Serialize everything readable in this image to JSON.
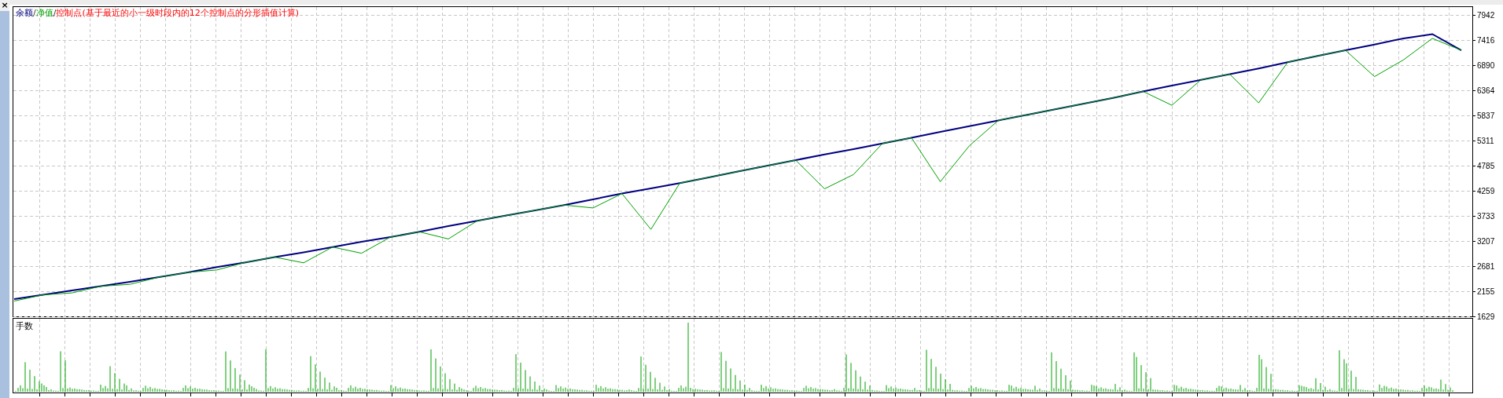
{
  "close_button": {
    "label": "×"
  },
  "legend": {
    "separator": "/",
    "label": "控制点(基于最近的小一级时段内的12个控制点的分形插值计算)"
  },
  "chart_data": {
    "type": "line",
    "grid": true,
    "series": [
      {
        "name": "余额",
        "color": "#000080",
        "values": [
          1990,
          2080,
          2170,
          2260,
          2350,
          2450,
          2550,
          2660,
          2760,
          2870,
          2970,
          3080,
          3190,
          3290,
          3400,
          3520,
          3630,
          3740,
          3850,
          3960,
          4080,
          4200,
          4310,
          4420,
          4540,
          4660,
          4780,
          4900,
          5020,
          5130,
          5250,
          5370,
          5490,
          5610,
          5730,
          5850,
          5970,
          6090,
          6210,
          6340,
          6460,
          6580,
          6700,
          6820,
          6950,
          7080,
          7200,
          7320,
          7450,
          7540,
          7200
        ]
      },
      {
        "name": "净值",
        "color": "#00a000",
        "values": [
          1950,
          2080,
          2120,
          2260,
          2300,
          2450,
          2550,
          2600,
          2760,
          2870,
          2750,
          3080,
          2950,
          3290,
          3400,
          3250,
          3630,
          3740,
          3850,
          3960,
          3900,
          4200,
          3450,
          4420,
          4540,
          4660,
          4780,
          4900,
          4300,
          4600,
          5250,
          5370,
          4450,
          5200,
          5730,
          5850,
          5970,
          6090,
          6210,
          6340,
          6050,
          6580,
          6700,
          6100,
          6950,
          7080,
          7200,
          6650,
          7000,
          7450,
          7200
        ]
      }
    ],
    "ylim": [
      1629,
      7942
    ],
    "yticks": [
      1629,
      2155,
      2681,
      3207,
      3733,
      4259,
      4785,
      5311,
      5837,
      6364,
      6890,
      7416,
      7942
    ]
  },
  "lots_panel": {
    "title": "手数"
  }
}
